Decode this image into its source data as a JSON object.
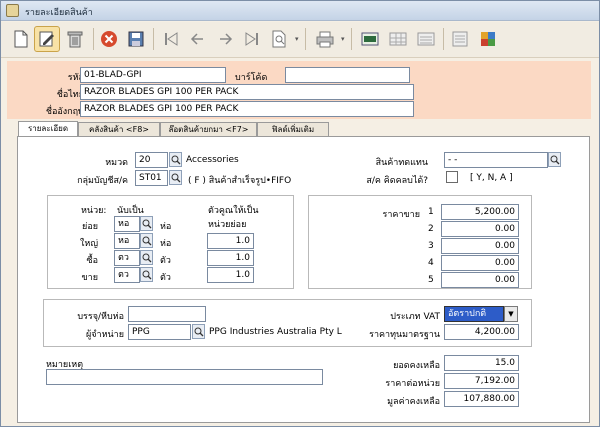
{
  "window": {
    "title": "รายละเอียดสินค้า"
  },
  "header": {
    "code_label": "รหัส",
    "code_value": "01-BLAD-GPI",
    "barcode_label": "บาร์โค้ด",
    "barcode_value": "",
    "thai_name_label": "ชื่อไทย",
    "thai_name_value": "RAZOR BLADES GPI 100 PER PACK",
    "eng_name_label": "ชื่ออังกฤษ",
    "eng_name_value": "RAZOR BLADES GPI 100 PER PACK"
  },
  "tabs": [
    {
      "label": "รายละเอียด"
    },
    {
      "label": "คลังสินค้า <F8>"
    },
    {
      "label": "ล๊อตสินค้ายกมา <F7>"
    },
    {
      "label": "ฟิลด์เพิ่มเติม"
    }
  ],
  "category": {
    "category_label": "หมวด",
    "category_code": "20",
    "category_name": "Accessories",
    "account_group_label": "กลุ่มบัญชีส/ค",
    "account_group_code": "ST01",
    "account_group_desc": "( F )  สินค้าสำเร็จรูป•FIFO",
    "substitute_label": "สินค้าทดแทน",
    "substitute_value": "-     -",
    "returnable_label": "ส/ค คิดคลบได้?",
    "returnable_hint": "[ Y, N, A ]"
  },
  "units": {
    "unit_header": "หน่วย:",
    "count_header": "นับเป็น",
    "multiplier_header": "ตัวคูณให้เป็น",
    "base_unit_header": "หน่วยย่อย",
    "rows": [
      {
        "label": "ย่อย",
        "unit": "หอ",
        "suffix": "ห่อ",
        "factor": ""
      },
      {
        "label": "ใหญ่",
        "unit": "หอ",
        "suffix": "ห่อ",
        "factor": "1.0"
      },
      {
        "label": "ซื้อ",
        "unit": "ตว",
        "suffix": "ตัว",
        "factor": "1.0"
      },
      {
        "label": "ขาย",
        "unit": "ตว",
        "suffix": "ตัว",
        "factor": "1.0"
      }
    ]
  },
  "prices": {
    "label": "ราคาขาย",
    "rows": [
      {
        "no": "1",
        "value": "5,200.00"
      },
      {
        "no": "2",
        "value": "0.00"
      },
      {
        "no": "3",
        "value": "0.00"
      },
      {
        "no": "4",
        "value": "0.00"
      },
      {
        "no": "5",
        "value": "0.00"
      }
    ]
  },
  "supply": {
    "pack_label": "บรรจุ/หีบห่อ",
    "pack_value": "",
    "vendor_label": "ผู้จำหน่าย",
    "vendor_code": "PPG",
    "vendor_name": "PPG Industries Australia Pty L",
    "vat_label": "ประเภท VAT",
    "vat_value": "อัตราปกติ",
    "std_cost_label": "ราคาทุนมาตรฐาน",
    "std_cost_value": "4,200.00"
  },
  "remark": {
    "label": "หมายเหตุ",
    "value": ""
  },
  "stock": {
    "balance_label": "ยอดคงเหลือ",
    "balance_value": "15.0",
    "unit_price_label": "ราคาต่อหน่วย",
    "unit_price_value": "7,192.00",
    "total_label": "มูลค่าคงเหลือ",
    "total_value": "107,880.00"
  }
}
